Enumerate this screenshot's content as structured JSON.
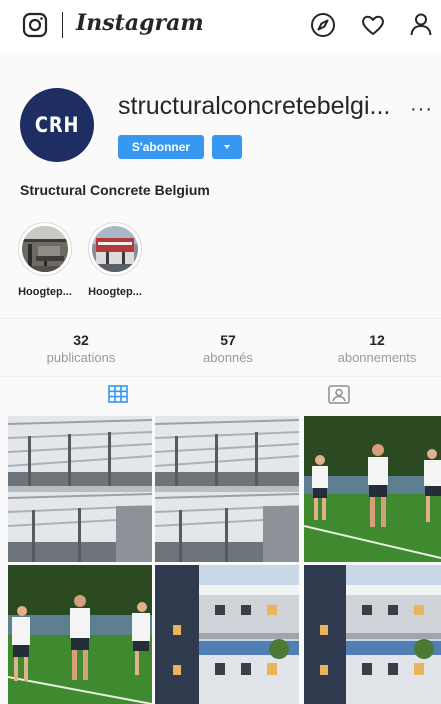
{
  "nav": {
    "brand": "Instagram",
    "icons": [
      "instagram-logo-icon",
      "compass-icon",
      "heart-icon",
      "user-icon"
    ]
  },
  "profile": {
    "avatar_text": "CRH",
    "username": "structuralconcretebelgi...",
    "follow_label": "S'abonner",
    "full_name": "Structural Concrete Belgium"
  },
  "highlights": [
    {
      "label": "Hoogtep..."
    },
    {
      "label": "Hoogtep..."
    }
  ],
  "stats": {
    "posts": {
      "value": "32",
      "label": "publications"
    },
    "followers": {
      "value": "57",
      "label": "abonnés"
    },
    "following": {
      "value": "12",
      "label": "abonnements"
    }
  },
  "tabs": [
    "grid-icon",
    "tagged-icon"
  ],
  "colors": {
    "accent": "#3897f0",
    "avatar_bg": "#1f2e62",
    "text": "#262626",
    "muted": "#999999"
  }
}
